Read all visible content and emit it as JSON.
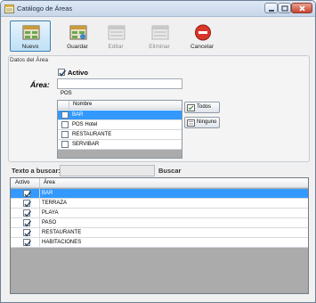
{
  "window": {
    "title": "Catálogo de Áreas"
  },
  "toolbar": {
    "buttons": [
      {
        "label": "Nuevo",
        "icon": "new-record-icon",
        "state": "active"
      },
      {
        "label": "Guardar",
        "icon": "save-icon",
        "state": "enabled"
      },
      {
        "label": "Editar",
        "icon": "edit-icon",
        "state": "disabled"
      },
      {
        "label": "Eliminar",
        "icon": "delete-icon",
        "state": "disabled"
      },
      {
        "label": "Cancelar",
        "icon": "cancel-icon",
        "state": "enabled"
      }
    ]
  },
  "form": {
    "group_title": "Datos del Área",
    "activo_label": "Activo",
    "activo_checked": true,
    "area_label": "Área:",
    "area_value": "",
    "pos_label": "POS",
    "pos_column": "Nombre",
    "pos_items": [
      {
        "name": "BAR",
        "checked": false,
        "selected": true
      },
      {
        "name": "POS Hotel",
        "checked": false,
        "selected": false
      },
      {
        "name": "RESTAURANTE",
        "checked": false,
        "selected": false
      },
      {
        "name": "SERVIBAR",
        "checked": false,
        "selected": false
      }
    ],
    "todos_label": "Todos",
    "ninguno_label": "Ninguno"
  },
  "search": {
    "label": "Texto a buscar:",
    "value": "",
    "button_label": "Buscar"
  },
  "grid": {
    "columns": [
      "Activo",
      "Área"
    ],
    "rows": [
      {
        "activo": true,
        "area": "BAR",
        "selected": true
      },
      {
        "activo": true,
        "area": "TERRAZA",
        "selected": false
      },
      {
        "activo": true,
        "area": "PLAYA",
        "selected": false
      },
      {
        "activo": true,
        "area": "PASO",
        "selected": false
      },
      {
        "activo": true,
        "area": "RESTAURANTE",
        "selected": false
      },
      {
        "activo": true,
        "area": "HABITACIONES",
        "selected": false
      }
    ]
  },
  "colors": {
    "selection": "#3399ff",
    "accent_border": "#3c7fb1",
    "grid_empty": "#ababab"
  }
}
